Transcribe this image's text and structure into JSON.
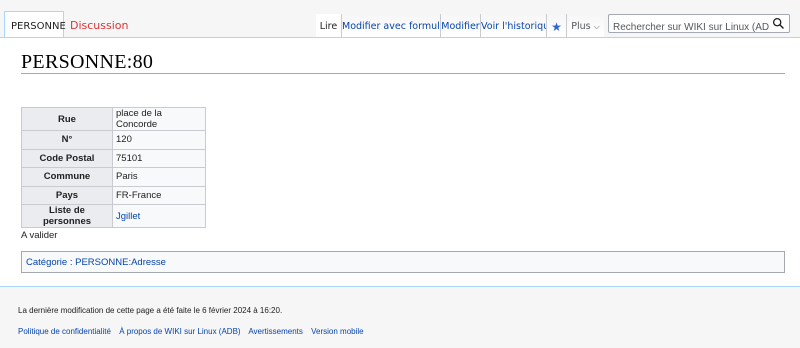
{
  "tabs": {
    "namespace_tab": "PERSONNE",
    "discussion_tab": "Discussion",
    "read": "Lire",
    "edit_form": "Modifier avec formulaire",
    "edit": "Modifier",
    "history": "Voir l'historique",
    "more": "Plus"
  },
  "search": {
    "placeholder": "Rechercher sur WIKI sur Linux (ADB)"
  },
  "page": {
    "title": "PERSONNE:80",
    "status": "A valider"
  },
  "infobox": {
    "rows": [
      {
        "label": "Rue",
        "value": "place de la Concorde"
      },
      {
        "label": "N°",
        "value": "120"
      },
      {
        "label": "Code Postal",
        "value": "75101"
      },
      {
        "label": "Commune",
        "value": "Paris"
      },
      {
        "label": "Pays",
        "value": "FR-France"
      },
      {
        "label": "Liste de personnes",
        "value": "Jgillet"
      }
    ]
  },
  "categories": {
    "label": "Catégorie",
    "separator": " : ",
    "items": [
      "PERSONNE:Adresse"
    ]
  },
  "footer": {
    "last_modified": "La dernière modification de cette page a été faite le 6 février 2024 à 16:20.",
    "links": [
      "Politique de confidentialité",
      "À propos de WIKI sur Linux (ADB)",
      "Avertissements",
      "Version mobile"
    ]
  },
  "colors": {
    "link": "#0645ad",
    "red_link": "#d33",
    "tab_border": "#a7d7f9",
    "header_cell": "#eaecf0"
  },
  "icons": {
    "watch": "star-icon",
    "more": "chevron-down-icon",
    "search": "search-icon"
  }
}
